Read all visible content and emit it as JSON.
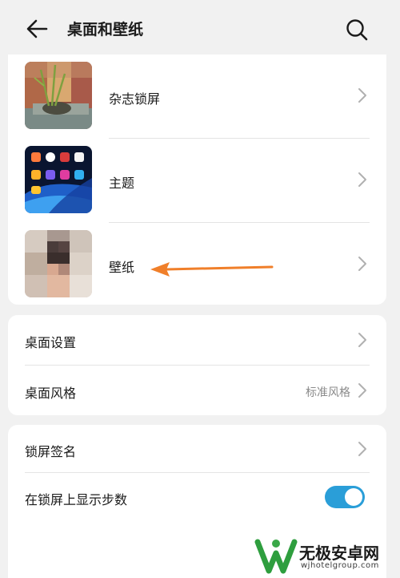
{
  "header": {
    "title": "桌面和壁纸",
    "back_icon": "arrow-left-icon",
    "search_icon": "search-icon"
  },
  "theme_section": {
    "items": [
      {
        "label": "杂志锁屏",
        "thumbnail": "magazine-lockscreen-thumbnail"
      },
      {
        "label": "主题",
        "thumbnail": "theme-thumbnail"
      },
      {
        "label": "壁纸",
        "thumbnail": "wallpaper-thumbnail"
      }
    ]
  },
  "desktop_section": {
    "items": [
      {
        "label": "桌面设置",
        "value": ""
      },
      {
        "label": "桌面风格",
        "value": "标准风格"
      }
    ]
  },
  "lockscreen_section": {
    "items": [
      {
        "label": "锁屏签名"
      },
      {
        "label": "在锁屏上显示步数",
        "toggle_on": true
      }
    ]
  },
  "annotation": {
    "color": "#f07f2a"
  },
  "watermark": {
    "brand": "无极安卓网",
    "url": "wjhotelgroup.com"
  },
  "colors": {
    "accent": "#2a9ed8",
    "background": "#f1f1f1",
    "card": "#ffffff",
    "chevron": "#b0b0b0"
  }
}
